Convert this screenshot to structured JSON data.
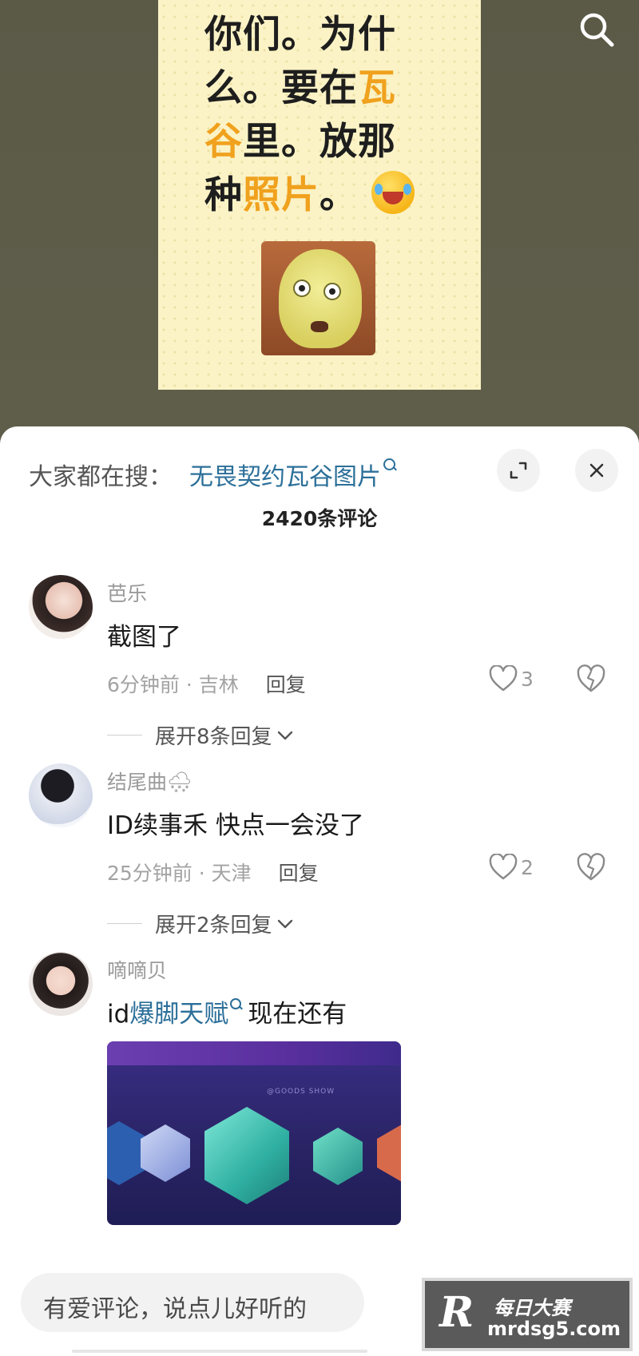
{
  "meme": {
    "line1": "你们。为什",
    "line2": "么。要在",
    "line2_hl": "瓦",
    "line3_hl": "谷",
    "line3": "里。放那",
    "line4": "种",
    "line4_hl": "照片",
    "line4_end": "。"
  },
  "sheet": {
    "hot_prefix": "大家都在搜：",
    "hot_query": "无畏契约瓦谷图片",
    "comment_count": "2420条评论"
  },
  "comments": [
    {
      "name": "芭乐",
      "text": "截图了",
      "time_place": "6分钟前 · 吉林",
      "reply": "回复",
      "likes": "3",
      "expand": "展开8条回复"
    },
    {
      "name": "结尾曲🌨",
      "text": "ID续事禾 快点一会没了",
      "time_place": "25分钟前 · 天津",
      "reply": "回复",
      "likes": "2",
      "expand": "展开2条回复"
    },
    {
      "name": "嘀嘀贝",
      "text_prefix": "id",
      "text_link": "爆脚天赋",
      "text_suffix": "现在还有",
      "image_label": "@GOODS SHOW"
    }
  ],
  "input": {
    "placeholder": "有爱评论，说点儿好听的"
  },
  "watermark": {
    "logo": "R",
    "cn": "每日大赛",
    "url": "mrdsg5.com"
  },
  "colors": {
    "link": "#2b6f99",
    "highlight": "#f0a11d",
    "meme_bg": "#fbf3c6"
  }
}
